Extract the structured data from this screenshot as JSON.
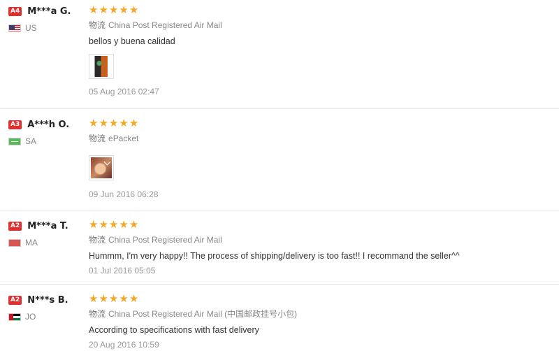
{
  "reviews": [
    {
      "level": "A4",
      "buyer": "M***a G.",
      "country": "US",
      "stars": 5,
      "shipping_label": "物流",
      "shipping_method": "China Post Registered Air Mail",
      "shipping_extra": "",
      "comment": "bellos y buena calidad",
      "has_photo": true,
      "date": "05 Aug 2016 02:47"
    },
    {
      "level": "A3",
      "buyer": "A***h O.",
      "country": "SA",
      "stars": 5,
      "shipping_label": "物流",
      "shipping_method": "ePacket",
      "shipping_extra": "",
      "comment": "",
      "has_photo": true,
      "date": "09 Jun 2016 06:28"
    },
    {
      "level": "A2",
      "buyer": "M***a T.",
      "country": "MA",
      "stars": 5,
      "shipping_label": "物流",
      "shipping_method": "China Post Registered Air Mail",
      "shipping_extra": "",
      "comment": "Hummm, I'm very happy!! The process of shipping/delivery is too fast!! I recommand the seller^^",
      "has_photo": false,
      "date": "01 Jul 2016 05:05"
    },
    {
      "level": "A2",
      "buyer": "N***s B.",
      "country": "JO",
      "stars": 5,
      "shipping_label": "物流",
      "shipping_method": "China Post Registered Air Mail",
      "shipping_extra": "(中国邮政挂号小包)",
      "comment": "According to specifications with fast delivery",
      "has_photo": false,
      "date": "20 Aug 2016 10:59"
    }
  ],
  "icons": {
    "star": "★",
    "star_color": "#f5a623",
    "badge_color": "#e0302e"
  }
}
